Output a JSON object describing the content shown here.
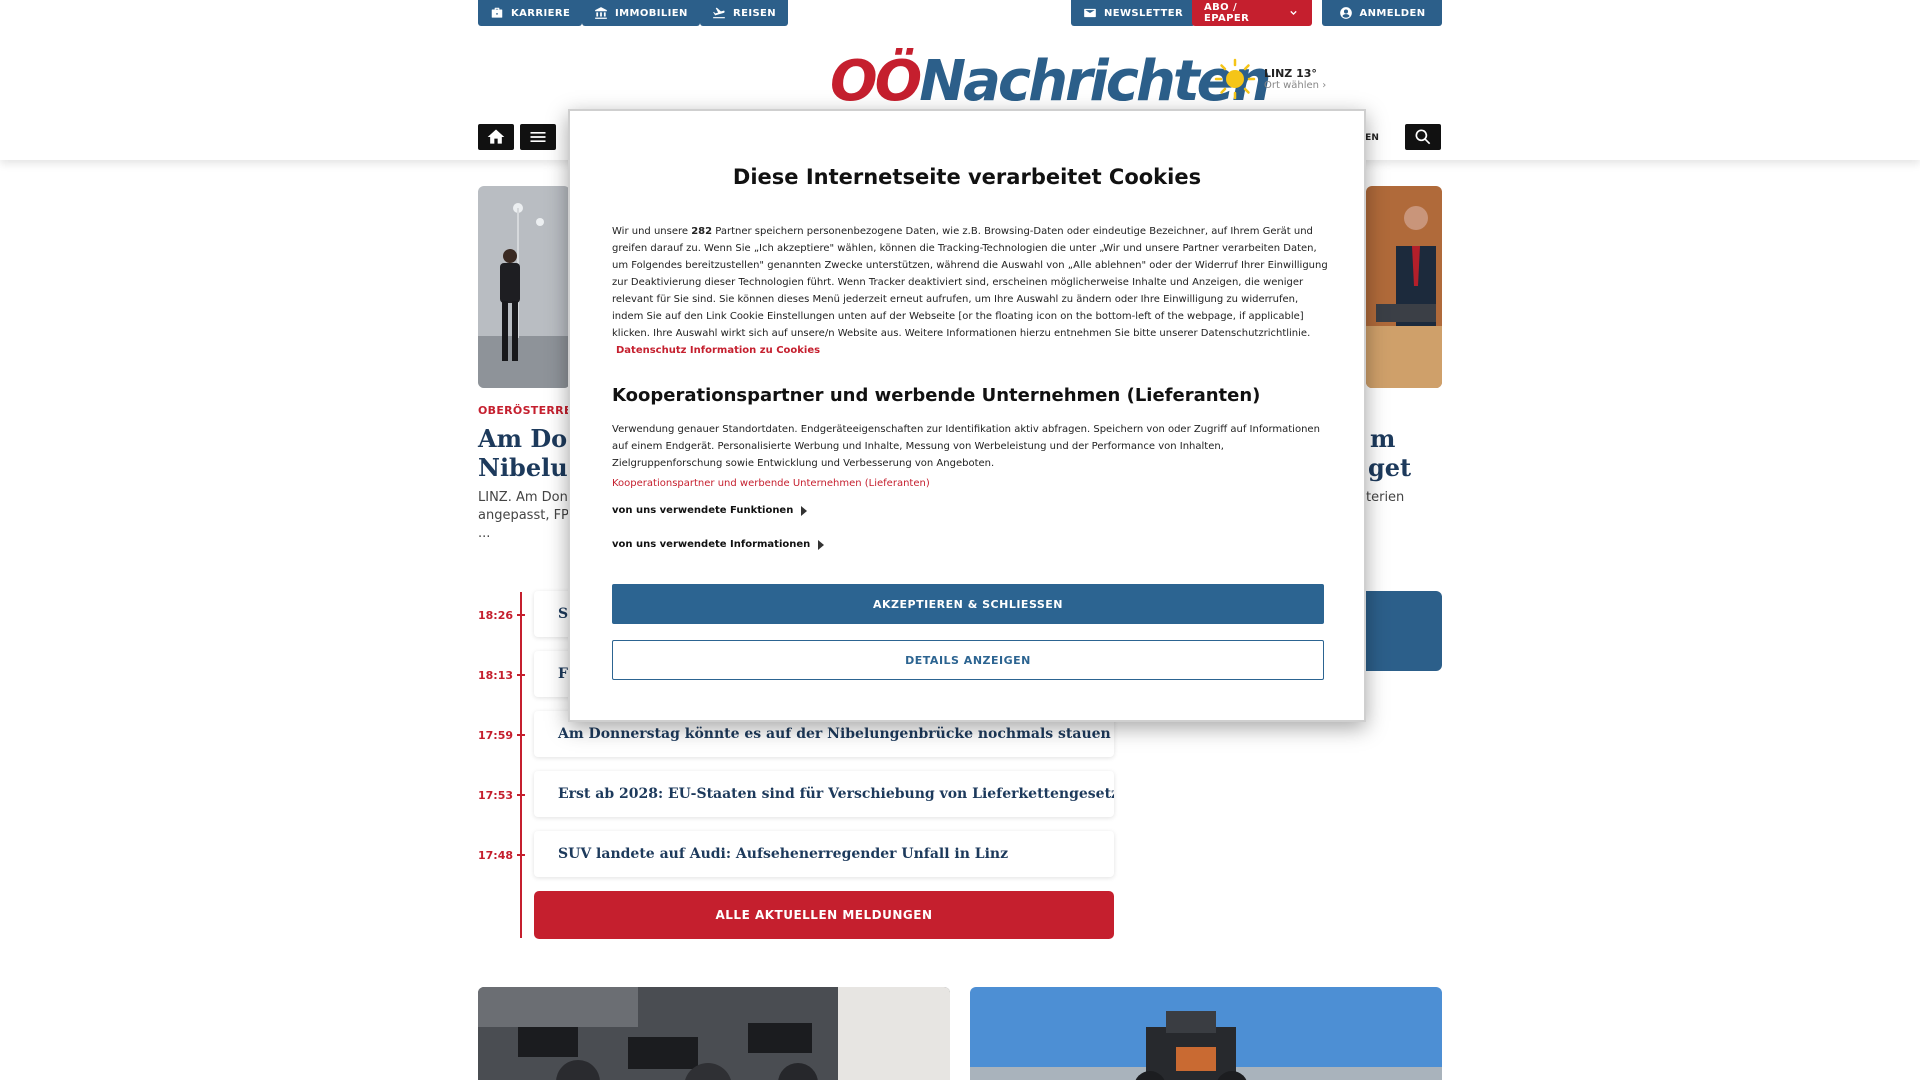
{
  "topbar": {
    "karriere": "KARRIERE",
    "immobilien": "IMMOBILIEN",
    "reisen": "REISEN",
    "newsletter": "NEWSLETTER",
    "abo": "ABO / EPAPER",
    "anmelden": "ANMELDEN"
  },
  "brand": {
    "logo_oo": "OÖ",
    "logo_nach": "Nachrichten",
    "red": "#c51f2e",
    "blue": "#2c5f8a"
  },
  "weather": {
    "city": "LINZ 13°",
    "pick": "Ort wählen"
  },
  "nav": {
    "partial": "ONEN"
  },
  "article_left": {
    "kicker": "OBERÖSTERREI",
    "headline_l1": "Am Don",
    "headline_l2": "Nibelun",
    "teaser_l1": "LINZ. Am Donn",
    "teaser_l2": "angepasst, FPÖ",
    "teaser_l3": "..."
  },
  "article_right": {
    "headline_l1": "m",
    "headline_l2": "get",
    "teaser_l1": "terien"
  },
  "ticker": {
    "items": [
      {
        "time": "18:26",
        "title": "S"
      },
      {
        "time": "18:13",
        "title": "F"
      },
      {
        "time": "17:59",
        "title": "Am Donnerstag könnte es auf der Nibelungenbrücke nochmals stauen"
      },
      {
        "time": "17:53",
        "title": "Erst ab 2028: EU-Staaten sind für Verschiebung von Lieferkettengesetz"
      },
      {
        "time": "17:48",
        "title": "SUV landete auf Audi: Aufsehenerregender Unfall in Linz"
      }
    ],
    "all_button": "ALLE AKTUELLEN MELDUNGEN"
  },
  "cookie": {
    "title": "Diese Internetseite verarbeitet Cookies",
    "body_pre": "Wir und unsere",
    "partner_count": "282",
    "body_post": "Partner speichern personenbezogene Daten, wie z.B. Browsing-Daten oder eindeutige Bezeichner, auf Ihrem Gerät und greifen darauf zu. Wenn Sie „Ich akzeptiere\" wählen, können die Tracking-Technologien die unter „Wir und unsere Partner verarbeiten Daten, um Folgendes bereitzustellen\" genannten Zwecke unterstützen, während die Auswahl von „Alle ablehnen\" oder der Widerruf Ihrer Einwilligung zur Deaktivierung dieser Technologien führt. Wenn Tracker deaktiviert sind, erscheinen möglicherweise Inhalte und Anzeigen, die weniger relevant für Sie sind. Sie können dieses Menü jederzeit erneut aufrufen, um Ihre Auswahl zu ändern oder Ihre Einwilligung zu widerrufen, indem Sie auf den Link Cookie Einstellungen unten auf der Webseite [or the floating icon on the bottom-left of the webpage, if applicable] klicken. Ihre Auswahl wirkt sich auf unsere/n Website aus. Weitere Informationen hierzu entnehmen Sie bitte unserer Datenschutzrichtlinie.",
    "privacy_link": "Datenschutz Information zu Cookies",
    "h2": "Kooperationspartner und werbende Unternehmen (Lieferanten)",
    "body2": "Verwendung genauer Standortdaten. Endgeräteeigenschaften zur Identifikation aktiv abfragen. Speichern von oder Zugriff auf Informationen auf einem Endgerät. Personalisierte Werbung und Inhalte, Messung von Werbeleistung und der Performance von Inhalten, Zielgruppenforschung sowie Entwicklung und Verbesserung von Angeboten.",
    "partners_link": "Kooperationspartner und werbende Unternehmen (Lieferanten)",
    "functions": "von uns verwendete Funktionen",
    "informations": "von uns verwendete Informationen",
    "accept": "AKZEPTIEREN & SCHLIESSEN",
    "details": "DETAILS ANZEIGEN"
  }
}
